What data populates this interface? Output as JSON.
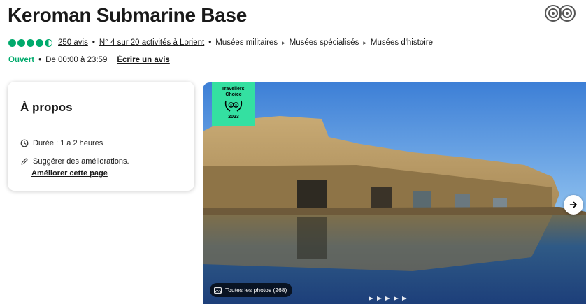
{
  "title": "Keroman Submarine Base",
  "logo_icon": "tripadvisor-owl-icon",
  "rating": {
    "bubbles": 4.5,
    "color": "#00aa6c"
  },
  "reviews_link": "250 avis",
  "rank_link": "N° 4 sur 20 activités à Lorient",
  "categories": [
    "Musées militaires",
    "Musées spécialisés",
    "Musées d'histoire"
  ],
  "status": {
    "open": "Ouvert",
    "hours": "De 00:00 à 23:59",
    "open_color": "#00aa6c"
  },
  "write_review": "Écrire un avis",
  "about": {
    "title": "À propos",
    "duration": "Durée : 1 à 2 heures",
    "suggest": "Suggérer des améliorations.",
    "improve_link": "Améliorer cette page"
  },
  "gallery": {
    "badge_line1": "Travellers'",
    "badge_line2": "Choice",
    "badge_year": "2023",
    "badge_color": "#34e0a1",
    "all_photos": "Toutes les photos (268)"
  }
}
